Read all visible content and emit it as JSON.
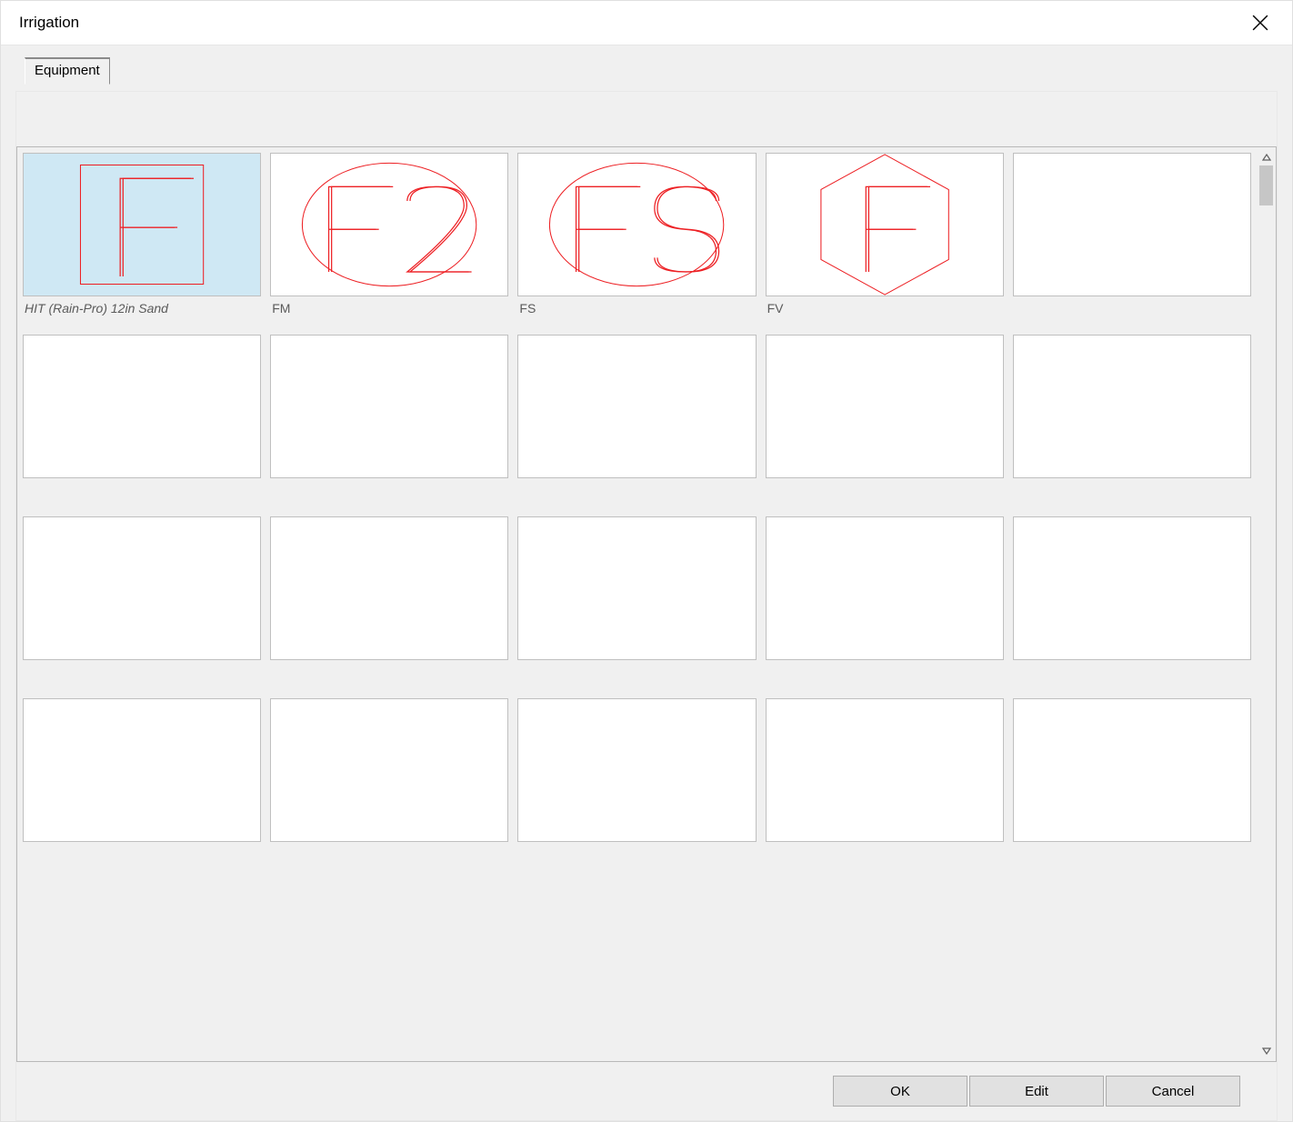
{
  "window": {
    "title": "Irrigation"
  },
  "tabs": {
    "active": "Equipment"
  },
  "buttons": {
    "ok": "OK",
    "edit": "Edit",
    "cancel": "Cancel"
  },
  "symbol_color": "#ed2024",
  "grid": {
    "columns": 5,
    "rows": 4,
    "items": [
      {
        "label": "HIT (Rain-Pro) 12in Sand",
        "shape": "rect",
        "text": "F",
        "selected": true
      },
      {
        "label": "FM",
        "shape": "ellipse",
        "text": "F2",
        "selected": false
      },
      {
        "label": "FS",
        "shape": "ellipse",
        "text": "FS",
        "selected": false
      },
      {
        "label": "FV",
        "shape": "hexagon",
        "text": "F",
        "selected": false
      },
      {
        "label": "",
        "shape": "none",
        "text": "",
        "selected": false
      },
      {
        "label": "",
        "shape": "none",
        "text": "",
        "selected": false
      },
      {
        "label": "",
        "shape": "none",
        "text": "",
        "selected": false
      },
      {
        "label": "",
        "shape": "none",
        "text": "",
        "selected": false
      },
      {
        "label": "",
        "shape": "none",
        "text": "",
        "selected": false
      },
      {
        "label": "",
        "shape": "none",
        "text": "",
        "selected": false
      },
      {
        "label": "",
        "shape": "none",
        "text": "",
        "selected": false
      },
      {
        "label": "",
        "shape": "none",
        "text": "",
        "selected": false
      },
      {
        "label": "",
        "shape": "none",
        "text": "",
        "selected": false
      },
      {
        "label": "",
        "shape": "none",
        "text": "",
        "selected": false
      },
      {
        "label": "",
        "shape": "none",
        "text": "",
        "selected": false
      },
      {
        "label": "",
        "shape": "none",
        "text": "",
        "selected": false
      },
      {
        "label": "",
        "shape": "none",
        "text": "",
        "selected": false
      },
      {
        "label": "",
        "shape": "none",
        "text": "",
        "selected": false
      },
      {
        "label": "",
        "shape": "none",
        "text": "",
        "selected": false
      },
      {
        "label": "",
        "shape": "none",
        "text": "",
        "selected": false
      }
    ]
  }
}
